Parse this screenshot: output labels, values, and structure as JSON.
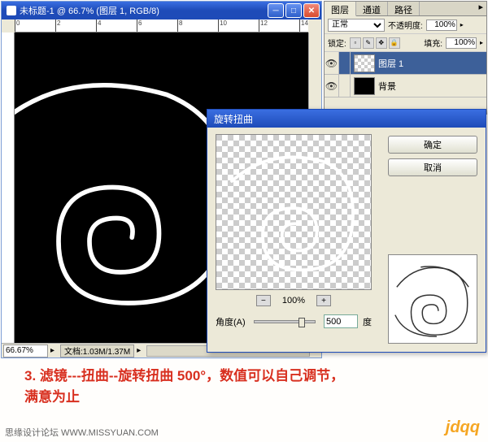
{
  "doc": {
    "title": "未标题-1 @ 66.7% (图层 1, RGB/8)",
    "zoom_display": "66.67%",
    "filesize": "文档:1.03M/1.37M",
    "ruler_ticks": [
      "0",
      "2",
      "4",
      "6",
      "8",
      "10",
      "12",
      "14"
    ]
  },
  "layers": {
    "tabs": [
      "图层",
      "通道",
      "路径"
    ],
    "blend_mode": "正常",
    "opacity_label": "不透明度:",
    "opacity": "100%",
    "lock_label": "锁定:",
    "fill_label": "填充:",
    "fill": "100%",
    "items": [
      {
        "name": "图层 1",
        "visible": true,
        "thumb": "checker",
        "active": true
      },
      {
        "name": "背景",
        "visible": true,
        "thumb": "black",
        "active": false
      }
    ]
  },
  "dialog": {
    "title": "旋转扭曲",
    "ok": "确定",
    "cancel": "取消",
    "zoom_minus": "−",
    "zoom_value": "100%",
    "zoom_plus": "+",
    "angle_label": "角度(A)",
    "angle_value": "500",
    "angle_unit": "度"
  },
  "caption": {
    "line1": "3. 滤镜---扭曲--旋转扭曲 500°，数值可以自己调节，",
    "line2": "满意为止"
  },
  "footer": {
    "attrib": "思缘设计论坛  WWW.MISSYUAN.COM",
    "brand": "jdqq"
  }
}
